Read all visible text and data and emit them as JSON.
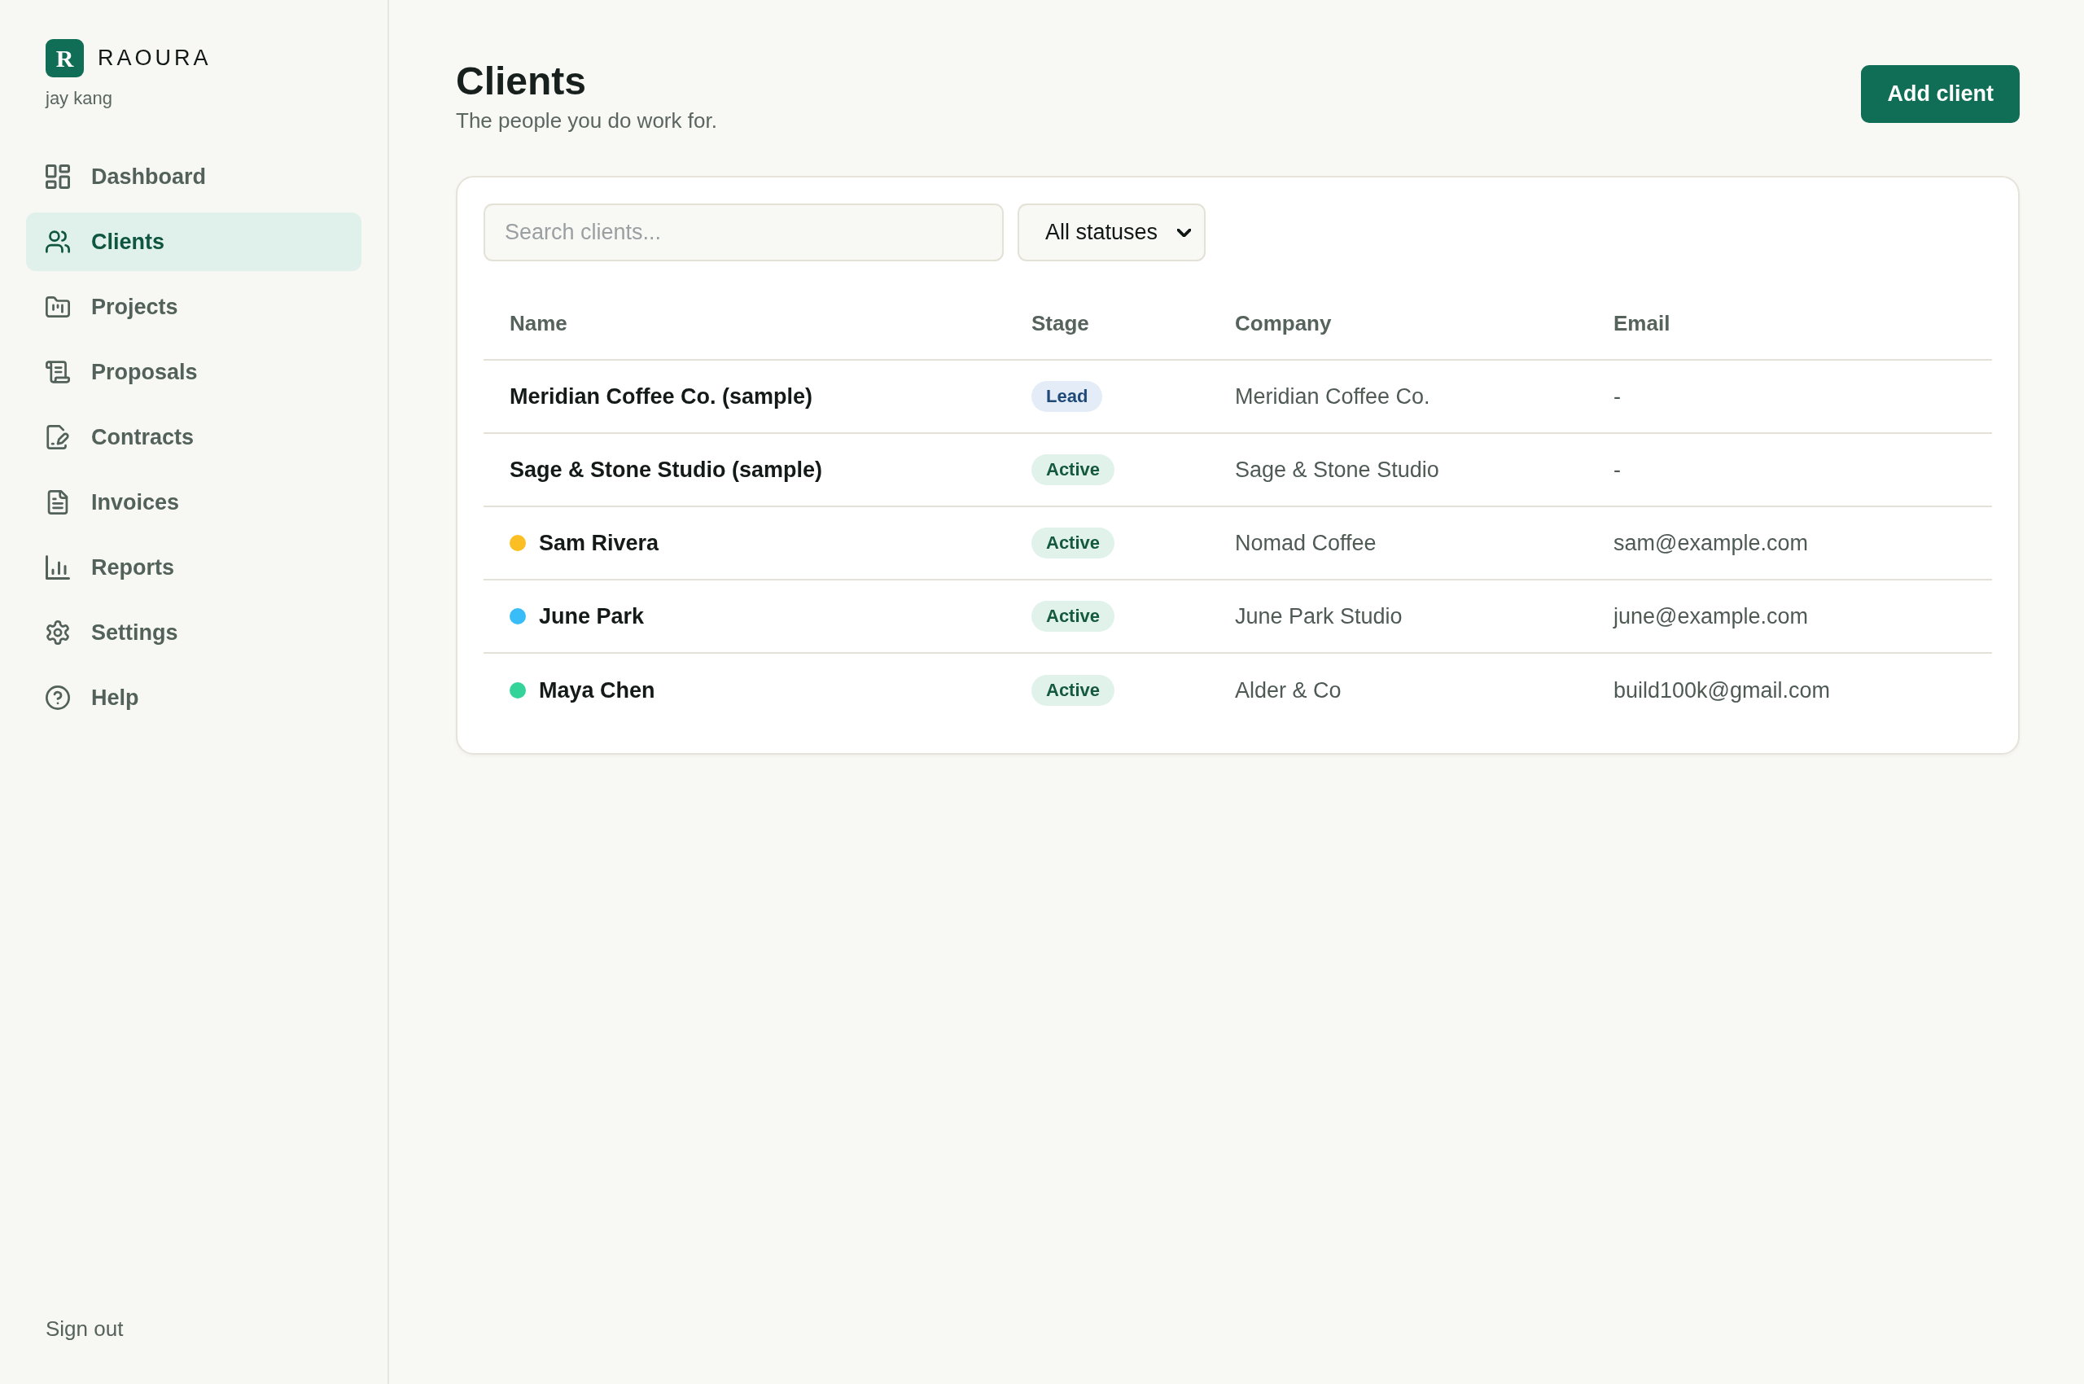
{
  "sidebar": {
    "logo": {
      "letter": "R",
      "name": "RAOURA"
    },
    "user": "jay kang",
    "items": [
      {
        "label": "Dashboard",
        "selected": false
      },
      {
        "label": "Clients",
        "selected": true
      },
      {
        "label": "Projects",
        "selected": false
      },
      {
        "label": "Proposals",
        "selected": false
      },
      {
        "label": "Contracts",
        "selected": false
      },
      {
        "label": "Invoices",
        "selected": false
      },
      {
        "label": "Reports",
        "selected": false
      },
      {
        "label": "Settings",
        "selected": false
      },
      {
        "label": "Help",
        "selected": false
      }
    ],
    "sign_out": "Sign out"
  },
  "header": {
    "title": "Clients",
    "subtitle": "The people you do work for.",
    "add_button": "Add client"
  },
  "clients_panel": {
    "search": {
      "placeholder": "Search clients..."
    },
    "status_filter": {
      "value": "All statuses"
    },
    "table": {
      "columns": [
        "Name",
        "Stage",
        "Company",
        "Email"
      ],
      "rows": [
        {
          "name": "Meridian Coffee Co. (sample)",
          "stage": {
            "label": "Lead",
            "kind": "lead"
          },
          "company": "Meridian Coffee Co.",
          "email": "-"
        },
        {
          "name": "Sage & Stone Studio (sample)",
          "stage": {
            "label": "Active",
            "kind": "active"
          },
          "company": "Sage & Stone Studio",
          "email": "-"
        },
        {
          "name": "Sam Rivera",
          "color": "#fbbf24",
          "stage": {
            "label": "Active",
            "kind": "active"
          },
          "company": "Nomad Coffee",
          "email": "sam@example.com"
        },
        {
          "name": "June Park",
          "color": "#38bdf8",
          "stage": {
            "label": "Active",
            "kind": "active"
          },
          "company": "June Park Studio",
          "email": "june@example.com"
        },
        {
          "name": "Maya Chen",
          "color": "#34d399",
          "stage": {
            "label": "Active",
            "kind": "active"
          },
          "company": "Alder & Co",
          "email": "build100k@gmail.com"
        }
      ]
    }
  }
}
